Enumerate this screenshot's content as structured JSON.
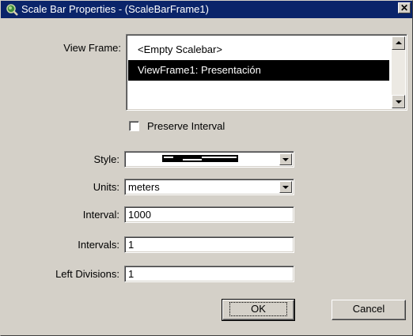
{
  "window": {
    "title": "Scale Bar Properties - (ScaleBarFrame1)",
    "close_glyph": "✕"
  },
  "view_frame": {
    "label": "View Frame:",
    "items": [
      {
        "label": "<Empty Scalebar>",
        "selected": false
      },
      {
        "label": "ViewFrame1: Presentación",
        "selected": true
      }
    ]
  },
  "preserve_interval": {
    "label": "Preserve Interval",
    "checked": false
  },
  "style": {
    "label": "Style:"
  },
  "units": {
    "label": "Units:",
    "value": "meters"
  },
  "interval": {
    "label": "Interval:",
    "value": "1000"
  },
  "intervals": {
    "label": "Intervals:",
    "value": "1"
  },
  "left_divisions": {
    "label": "Left Divisions:",
    "value": "1"
  },
  "buttons": {
    "ok": "OK",
    "cancel": "Cancel"
  },
  "colors": {
    "titlebar": "#0a246a",
    "dialog": "#d4d0c8",
    "selection": "#000000"
  }
}
